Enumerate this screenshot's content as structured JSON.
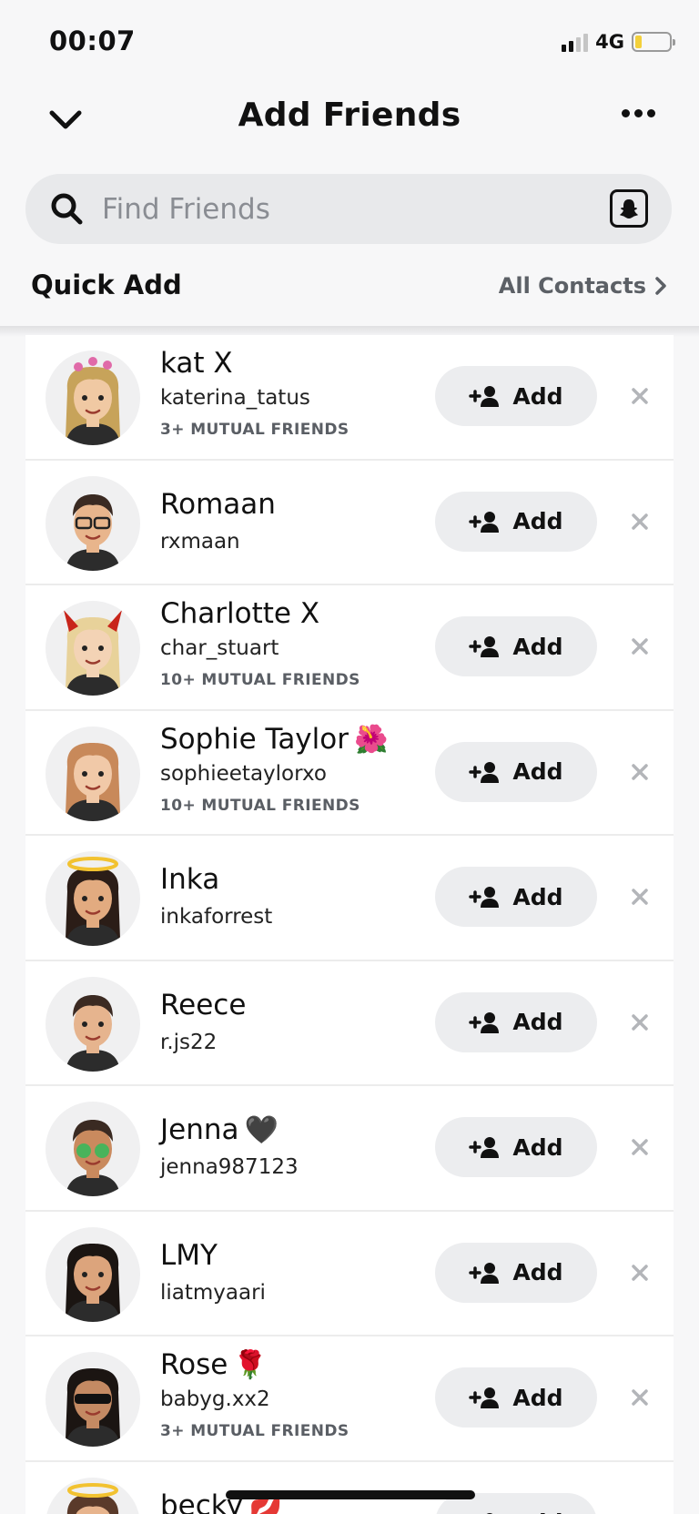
{
  "status_bar": {
    "time": "00:07",
    "network": "4G",
    "signal_bars": 2,
    "battery_level": 0.2
  },
  "header": {
    "title": "Add Friends"
  },
  "search": {
    "placeholder": "Find Friends"
  },
  "quick_add": {
    "title": "Quick Add",
    "all_contacts_label": "All Contacts"
  },
  "add_label": "Add",
  "colors": {
    "background": "#f7f7f8",
    "button_bg": "#ecedef",
    "muted_text": "#5a5e64"
  },
  "friends": [
    {
      "name": "kat X",
      "emoji": "",
      "username": "katerina_tatus",
      "mutual": "3+ MUTUAL FRIENDS",
      "avatar": "curly-hair-hearts",
      "skin": "#f0c9a3",
      "hair": "#c7a35a"
    },
    {
      "name": "Romaan",
      "emoji": "",
      "username": "rxmaan",
      "mutual": "",
      "avatar": "glasses-beard",
      "skin": "#e8b58c",
      "hair": "#3a2a22"
    },
    {
      "name": "Charlotte X",
      "emoji": "",
      "username": "char_stuart",
      "mutual": "10+ MUTUAL FRIENDS",
      "avatar": "devil-horns",
      "skin": "#f3d3b5",
      "hair": "#e8d29a"
    },
    {
      "name": "Sophie Taylor",
      "emoji": "🌺",
      "username": "sophieetaylorxo",
      "mutual": "10+ MUTUAL FRIENDS",
      "avatar": "long-hair",
      "skin": "#f1c9a8",
      "hair": "#c8895a"
    },
    {
      "name": "Inka",
      "emoji": "",
      "username": "inkaforrest",
      "mutual": "",
      "avatar": "halo",
      "skin": "#e2ab80",
      "hair": "#2b1d17"
    },
    {
      "name": "Reece",
      "emoji": "",
      "username": "r.js22",
      "mutual": "",
      "avatar": "short-hair",
      "skin": "#e6b48e",
      "hair": "#3b2a22"
    },
    {
      "name": "Jenna",
      "emoji": "🖤",
      "username": "jenna987123",
      "mutual": "",
      "avatar": "money-eyes",
      "skin": "#c98a5e",
      "hair": "#3a2a22"
    },
    {
      "name": "LMY",
      "emoji": "",
      "username": "liatmyaari",
      "mutual": "",
      "avatar": "long-dark-hair",
      "skin": "#dca47c",
      "hair": "#1b1512"
    },
    {
      "name": "Rose",
      "emoji": "🌹",
      "username": "babyg.xx2",
      "mutual": "3+ MUTUAL FRIENDS",
      "avatar": "sunglasses",
      "skin": "#c48a63",
      "hair": "#1b1512"
    },
    {
      "name": "becky",
      "emoji": "💋",
      "username": "",
      "mutual": "",
      "avatar": "halo",
      "skin": "#e7b48d",
      "hair": "#5a3a2a"
    }
  ]
}
